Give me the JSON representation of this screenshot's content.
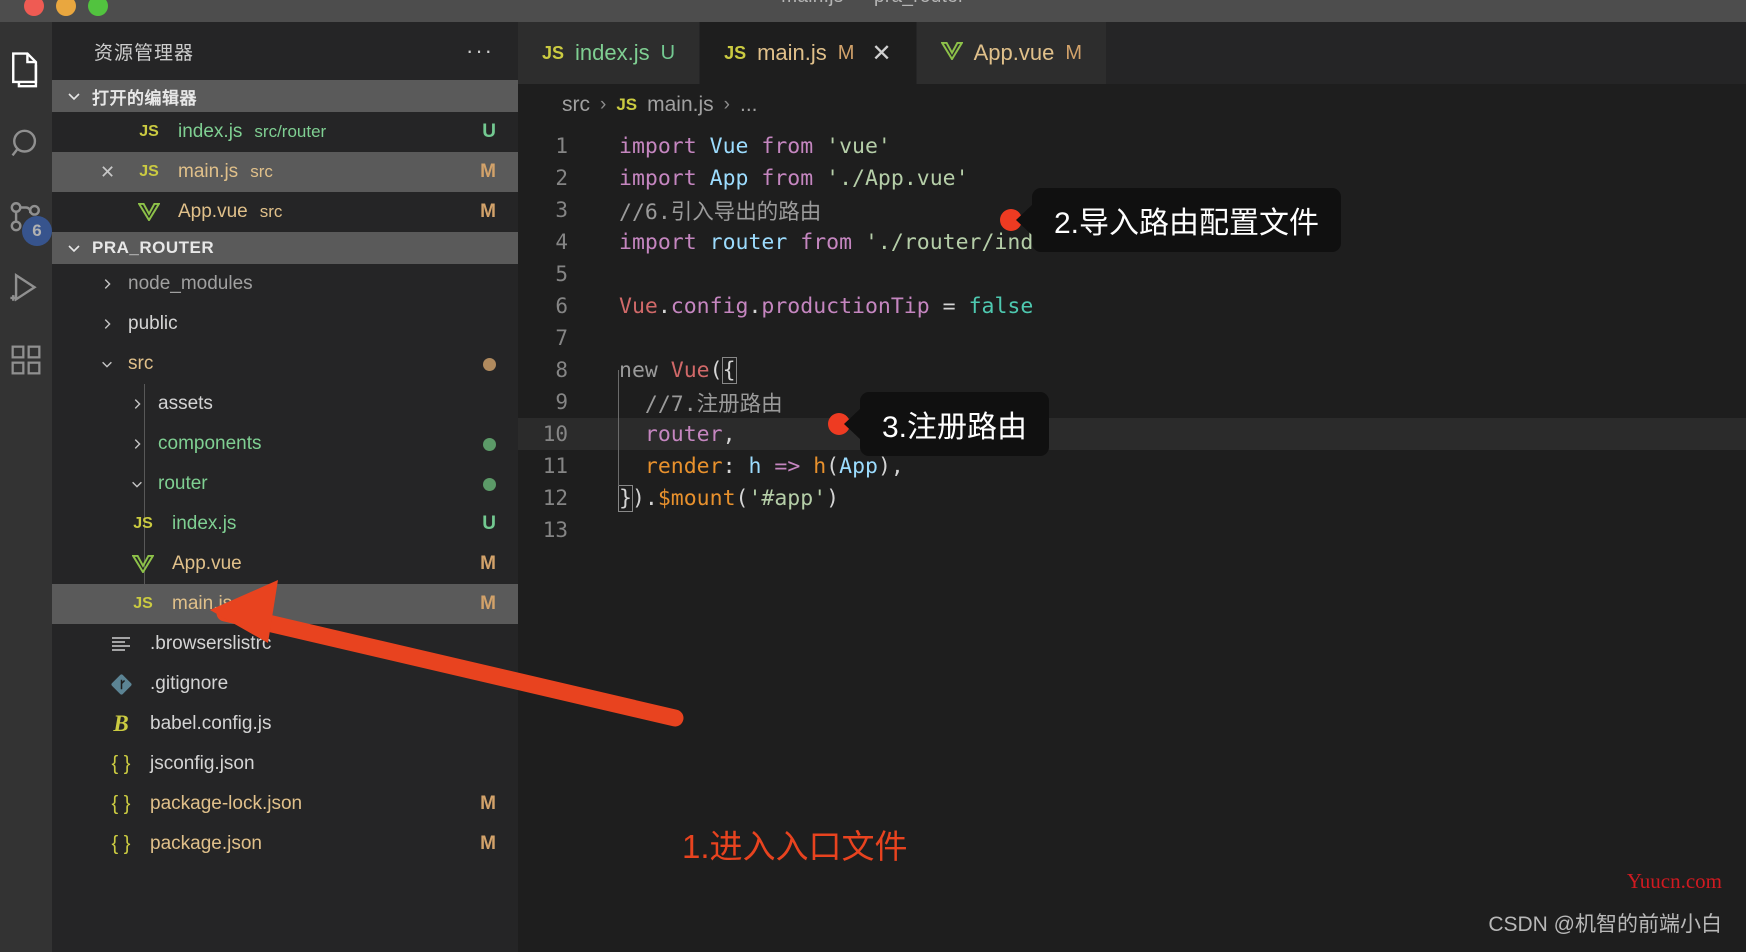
{
  "window": {
    "title": "main.js — pra_router",
    "traffic_lights": [
      "close",
      "minimize",
      "zoom"
    ]
  },
  "activitybar": {
    "items": [
      {
        "name": "explorer",
        "icon": "files-icon",
        "active": true,
        "badge": null
      },
      {
        "name": "search",
        "icon": "search-icon",
        "active": false,
        "badge": null
      },
      {
        "name": "source-control",
        "icon": "source-control-icon",
        "active": false,
        "badge": "6"
      },
      {
        "name": "run-and-debug",
        "icon": "run-debug-icon",
        "active": false,
        "badge": null
      },
      {
        "name": "extensions",
        "icon": "extensions-icon",
        "active": false,
        "badge": null
      }
    ]
  },
  "sidebar": {
    "header_title": "资源管理器",
    "more_actions": "···",
    "open_editors": {
      "label": "打开的编辑器",
      "items": [
        {
          "icon": "js-file-icon",
          "name": "index.js",
          "path": "src/router",
          "status": "U",
          "status_kind": "U",
          "selected": false,
          "closeable": false
        },
        {
          "icon": "js-file-icon",
          "name": "main.js",
          "path": "src",
          "status": "M",
          "status_kind": "M",
          "selected": true,
          "closeable": true
        },
        {
          "icon": "vue-file-icon",
          "name": "App.vue",
          "path": "src",
          "status": "M",
          "status_kind": "M",
          "selected": false,
          "closeable": false
        }
      ]
    },
    "project": {
      "label": "PRA_ROUTER",
      "tree": [
        {
          "icon": "chevron-right-icon",
          "type": "folder",
          "name": "node_modules",
          "depth": 0,
          "expanded": false,
          "color": "gray",
          "dot": null,
          "status": null,
          "selected": false
        },
        {
          "icon": "chevron-right-icon",
          "type": "folder",
          "name": "public",
          "depth": 0,
          "expanded": false,
          "color": "white",
          "dot": null,
          "status": null,
          "selected": false
        },
        {
          "icon": "chevron-down-icon",
          "type": "folder",
          "name": "src",
          "depth": 0,
          "expanded": true,
          "color": "tan",
          "dot": "#b08a5e",
          "status": null,
          "selected": false
        },
        {
          "icon": "chevron-right-icon",
          "type": "folder",
          "name": "assets",
          "depth": 1,
          "expanded": false,
          "color": "white",
          "dot": null,
          "status": null,
          "selected": false
        },
        {
          "icon": "chevron-right-icon",
          "type": "folder",
          "name": "components",
          "depth": 1,
          "expanded": false,
          "color": "green",
          "dot": "#5c9a68",
          "status": null,
          "selected": false
        },
        {
          "icon": "chevron-down-icon",
          "type": "folder",
          "name": "router",
          "depth": 1,
          "expanded": true,
          "color": "green",
          "dot": "#5c9a68",
          "status": null,
          "selected": false
        },
        {
          "icon": "js-file-icon",
          "type": "file",
          "name": "index.js",
          "depth": 1,
          "expanded": null,
          "color": "green",
          "dot": null,
          "status": "U",
          "selected": false
        },
        {
          "icon": "vue-file-icon",
          "type": "file",
          "name": "App.vue",
          "depth": 1,
          "expanded": null,
          "color": "tan",
          "dot": null,
          "status": "M",
          "selected": false
        },
        {
          "icon": "js-file-icon",
          "type": "file",
          "name": "main.js",
          "depth": 1,
          "expanded": null,
          "color": "tan",
          "dot": null,
          "status": "M",
          "selected": true
        },
        {
          "icon": "browserslist-icon",
          "type": "file",
          "name": ".browserslistrc",
          "depth": 0,
          "expanded": null,
          "color": "white",
          "dot": null,
          "status": null,
          "selected": false
        },
        {
          "icon": "git-icon",
          "type": "file",
          "name": ".gitignore",
          "depth": 0,
          "expanded": null,
          "color": "white",
          "dot": null,
          "status": null,
          "selected": false
        },
        {
          "icon": "babel-icon",
          "type": "file",
          "name": "babel.config.js",
          "depth": 0,
          "expanded": null,
          "color": "white",
          "dot": null,
          "status": null,
          "selected": false
        },
        {
          "icon": "json-icon",
          "type": "file",
          "name": "jsconfig.json",
          "depth": 0,
          "expanded": null,
          "color": "white",
          "dot": null,
          "status": null,
          "selected": false
        },
        {
          "icon": "json-icon",
          "type": "file",
          "name": "package-lock.json",
          "depth": 0,
          "expanded": null,
          "color": "tan",
          "dot": null,
          "status": "M",
          "selected": false
        },
        {
          "icon": "json-icon",
          "type": "file",
          "name": "package.json",
          "depth": 0,
          "expanded": null,
          "color": "tan",
          "dot": null,
          "status": "M",
          "selected": false
        }
      ]
    }
  },
  "editor": {
    "tabs": [
      {
        "icon": "js-file-icon",
        "label": "index.js",
        "modifier": "U",
        "active": false,
        "closeable": false
      },
      {
        "icon": "js-file-icon",
        "label": "main.js",
        "modifier": "M",
        "active": true,
        "closeable": true,
        "close_glyph": "✕"
      },
      {
        "icon": "vue-file-icon",
        "label": "App.vue",
        "modifier": "M",
        "active": false,
        "closeable": false
      }
    ],
    "breadcrumb": {
      "parts": [
        "src",
        "main.js",
        "..."
      ],
      "separator": "›",
      "file_icon": "js-file-icon"
    },
    "lines": [
      {
        "n": "1",
        "changed": false,
        "highlight": false
      },
      {
        "n": "2",
        "changed": false,
        "highlight": false
      },
      {
        "n": "3",
        "changed": true,
        "highlight": false
      },
      {
        "n": "4",
        "changed": true,
        "highlight": false
      },
      {
        "n": "5",
        "changed": false,
        "highlight": false
      },
      {
        "n": "6",
        "changed": false,
        "highlight": false
      },
      {
        "n": "7",
        "changed": false,
        "highlight": false
      },
      {
        "n": "8",
        "changed": false,
        "highlight": false
      },
      {
        "n": "9",
        "changed": true,
        "highlight": false
      },
      {
        "n": "10",
        "changed": true,
        "highlight": true
      },
      {
        "n": "11",
        "changed": false,
        "highlight": false
      },
      {
        "n": "12",
        "changed": false,
        "highlight": false
      },
      {
        "n": "13",
        "changed": false,
        "highlight": false
      }
    ],
    "code_text": {
      "l1": "import Vue from 'vue'",
      "l2": "import App from './App.vue'",
      "l3": "//6.引入导出的路由",
      "l4": "import router from './router/index'",
      "l5": "",
      "l6": "Vue.config.productionTip = false",
      "l7": "",
      "l8": "new Vue({",
      "l9": "  //7.注册路由",
      "l10": "  router,",
      "l11": "  render: h => h(App),",
      "l12": "}).$mount('#app')",
      "l13": ""
    }
  },
  "annotations": {
    "callout_2": "2.导入路由配置文件",
    "callout_3": "3.注册路由",
    "arrow_note": "1.进入入口文件"
  },
  "watermark": {
    "site": "Yuucn.com",
    "credit": "CSDN @机智的前端小白"
  },
  "colors": {
    "accent_red": "#ee3b22",
    "badge_blue": "#3b69c4",
    "modified_tan": "#d2a26a",
    "untracked_green": "#73c991",
    "watermark_red": "#cf1a21"
  }
}
